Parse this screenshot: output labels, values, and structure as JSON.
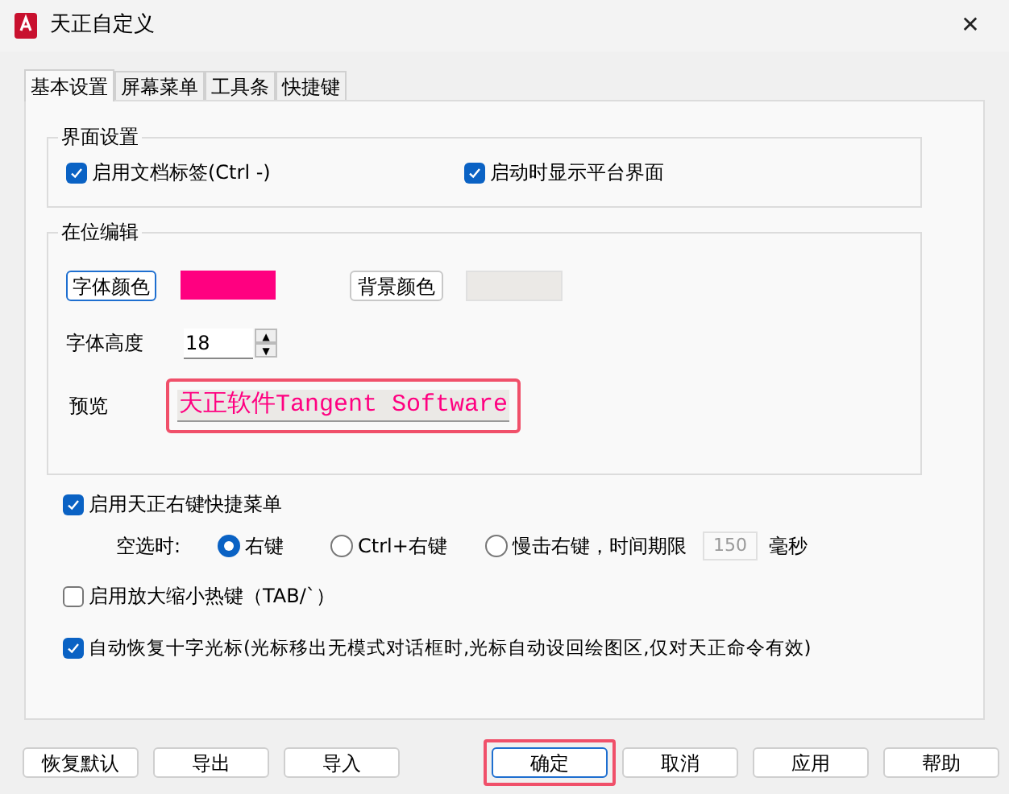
{
  "window": {
    "title": "天正自定义",
    "close": "✕"
  },
  "tabs": [
    {
      "label": "基本设置",
      "selected": true
    },
    {
      "label": "屏幕菜单",
      "selected": false
    },
    {
      "label": "工具条",
      "selected": false
    },
    {
      "label": "快捷键",
      "selected": false
    }
  ],
  "interface_group": {
    "title": "界面设置",
    "options": [
      {
        "label": "启用文档标签(Ctrl -)",
        "checked": true
      },
      {
        "label": "启动时显示平台界面",
        "checked": true
      }
    ]
  },
  "inplace_group": {
    "title": "在位编辑",
    "font_color_button": "字体颜色",
    "font_swatch": {
      "color": "#ff0080"
    },
    "bg_color_button": "背景颜色",
    "bg_swatch": {
      "color": "#ebe9e6"
    },
    "height_label": "字体高度",
    "height_value": "18",
    "spin_up": "▲",
    "spin_down": "▼",
    "preview_label": "预览",
    "preview_text": "天正软件Tangent Software",
    "preview_highlighted": true
  },
  "context_menu": {
    "label": "启用天正右键快捷菜单",
    "checked": true,
    "empty_label": "空选时:",
    "radios": [
      {
        "label": "右键",
        "selected": true
      },
      {
        "label": "Ctrl+右键",
        "selected": false
      },
      {
        "label": "慢击右键，时间期限",
        "selected": false
      }
    ],
    "time_value": "150",
    "time_unit": "毫秒"
  },
  "zoom_hotkey": {
    "label": "启用放大缩小热键（TAB/`）",
    "checked": false
  },
  "auto_cursor": {
    "label": "自动恢复十字光标(光标移出无模式对话框时,光标自动设回绘图区,仅对天正命令有效)",
    "checked": true
  },
  "buttons": [
    {
      "label": "恢复默认",
      "highlighted": false,
      "focused": false
    },
    {
      "label": "导出",
      "highlighted": false,
      "focused": false
    },
    {
      "label": "导入",
      "highlighted": false,
      "focused": false
    },
    {
      "label": "确定",
      "highlighted": true,
      "focused": true
    },
    {
      "label": "取消",
      "highlighted": false,
      "focused": false
    },
    {
      "label": "应用",
      "highlighted": false,
      "focused": false
    },
    {
      "label": "帮助",
      "highlighted": false,
      "focused": false
    }
  ]
}
